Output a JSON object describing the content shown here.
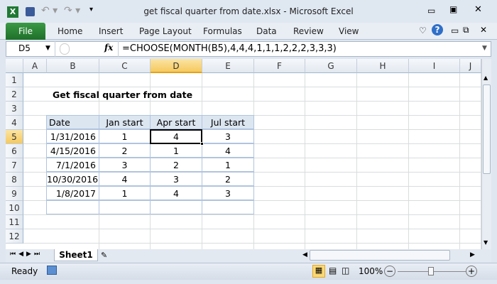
{
  "window": {
    "title": "get fiscal quarter from date.xlsx  -  Microsoft Excel"
  },
  "ribbon": {
    "tabs": [
      "File",
      "Home",
      "Insert",
      "Page Layout",
      "Formulas",
      "Data",
      "Review",
      "View"
    ]
  },
  "formula_bar": {
    "name_box": "D5",
    "fx": "fx",
    "formula": "=CHOOSE(MONTH(B5),4,4,4,1,1,1,2,2,2,3,3,3)"
  },
  "columns": [
    "A",
    "B",
    "C",
    "D",
    "E",
    "F",
    "G",
    "H",
    "I",
    "J"
  ],
  "rows": [
    "1",
    "2",
    "3",
    "4",
    "5",
    "6",
    "7",
    "8",
    "9",
    "10",
    "11",
    "12"
  ],
  "sheet": {
    "heading": "Get fiscal quarter from date",
    "table_headers": [
      "Date",
      "Jan start",
      "Apr start",
      "Jul start"
    ],
    "table_rows": [
      [
        "1/31/2016",
        "1",
        "4",
        "3"
      ],
      [
        "4/15/2016",
        "2",
        "1",
        "4"
      ],
      [
        "7/1/2016",
        "3",
        "2",
        "1"
      ],
      [
        "10/30/2016",
        "4",
        "3",
        "2"
      ],
      [
        "1/8/2017",
        "1",
        "4",
        "3"
      ],
      [
        "",
        "",
        "",
        ""
      ]
    ],
    "selected_cell": "D5"
  },
  "sheet_tabs": [
    "Sheet1"
  ],
  "status": {
    "ready": "Ready",
    "zoom": "100%",
    "zoom_level_percent": 100
  },
  "colors": {
    "header_fill": "#dce6f1",
    "file_tab": "#2a8535",
    "selection": "#000000"
  }
}
